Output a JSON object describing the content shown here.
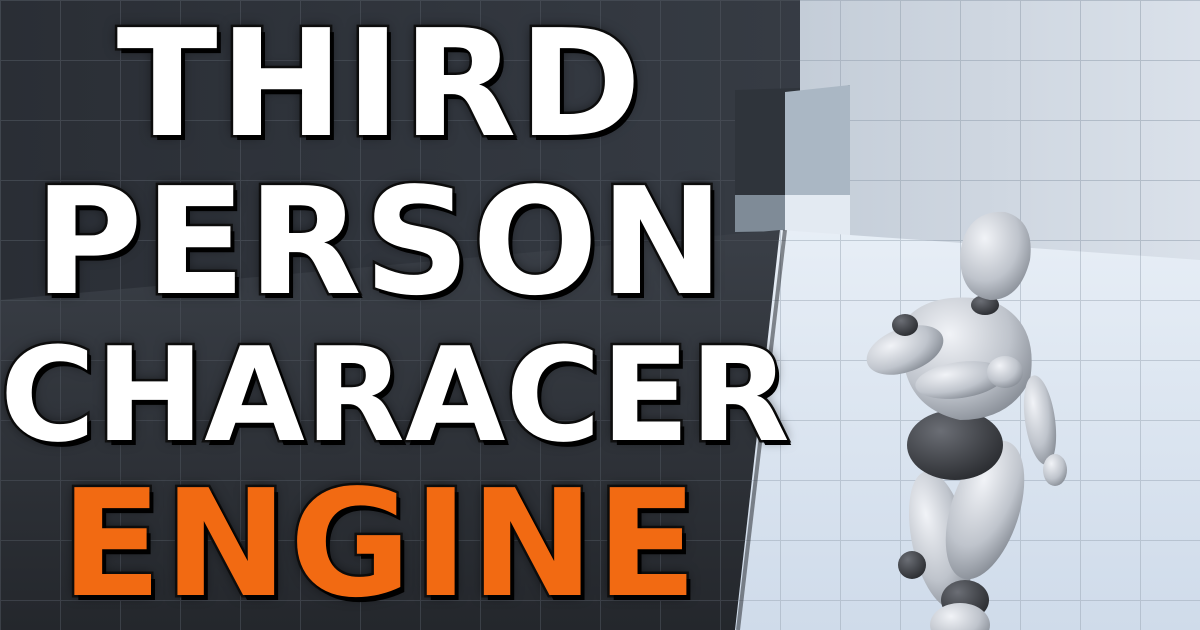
{
  "title": {
    "line1": "THIRD",
    "line2": "PERSON",
    "line3": "CHARACER",
    "line4": "ENGINE"
  },
  "colors": {
    "title_text": "#ffffff",
    "accent_text": "#f26a12",
    "shadow_wall": "#3a3f47",
    "lit_floor": "#dde7f3",
    "robot_body": "#c9ccd3",
    "robot_joint": "#3d3f44"
  }
}
